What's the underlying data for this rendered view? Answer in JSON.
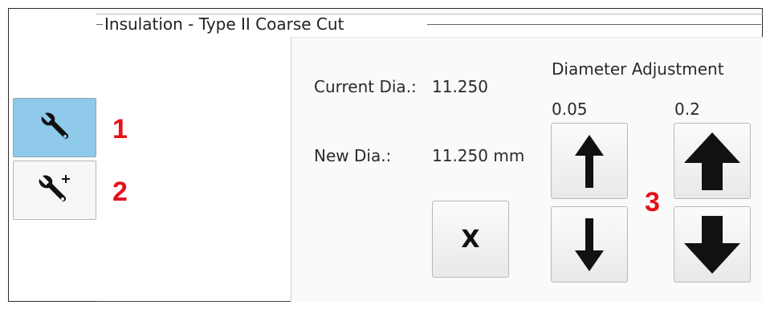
{
  "group": {
    "title": "Insulation - Type II Coarse Cut"
  },
  "sidebar": {
    "items": [
      {
        "icon": "wrench-icon",
        "marker": "1",
        "active": true
      },
      {
        "icon": "wrench-plus-icon",
        "marker": "2",
        "active": false
      }
    ]
  },
  "panel": {
    "current_label": "Current Dia.:",
    "current_value": "11.250",
    "new_label": "New Dia.:",
    "new_value": "11.250 mm",
    "adjust_title": "Diameter Adjustment",
    "step_small": "0.05",
    "step_large": "0.2",
    "marker": "3",
    "cancel_label": "X"
  },
  "colors": {
    "active_button": "#8ec9ea",
    "marker": "#e5121a"
  }
}
